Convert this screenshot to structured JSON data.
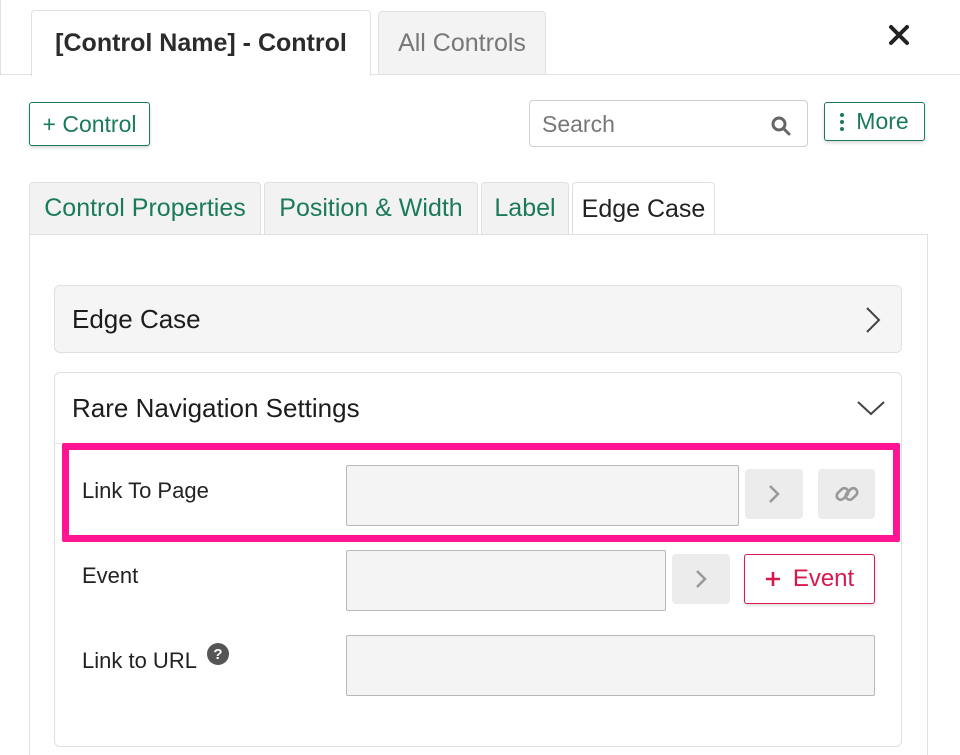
{
  "header": {
    "tabs": [
      {
        "label": "[Control Name] - Control",
        "active": true
      },
      {
        "label": "All Controls",
        "active": false
      }
    ],
    "close_glyph": "✕",
    "close_icon": "close-icon"
  },
  "toolbar": {
    "add_control_label": "+ Control",
    "search_placeholder": "Search",
    "search_icon": "search-icon",
    "more_label": "More",
    "more_icon": "vertical-dots-icon"
  },
  "sub_tabs": [
    {
      "label": "Control Properties",
      "active": false
    },
    {
      "label": "Position & Width",
      "active": false
    },
    {
      "label": "Label",
      "active": false
    },
    {
      "label": "Edge Case",
      "active": true
    }
  ],
  "sections": [
    {
      "title": "Edge Case",
      "expanded": false,
      "icon": "chevron-right-icon"
    },
    {
      "title": "Rare Navigation Settings",
      "expanded": true,
      "icon": "chevron-down-icon"
    }
  ],
  "form": {
    "link_to_page": {
      "label": "Link To Page",
      "value": "",
      "highlighted": true
    },
    "event": {
      "label": "Event",
      "value": "",
      "add_button_label": "Event",
      "add_button_icon": "plus-icon"
    },
    "link_to_url": {
      "label": "Link to URL",
      "value": "",
      "help_icon": "question-circle-icon",
      "help_glyph": "?"
    }
  },
  "colors": {
    "accent_green": "#1b7a5c",
    "event_red": "#d7194d",
    "highlight_pink": "#ff1493"
  }
}
